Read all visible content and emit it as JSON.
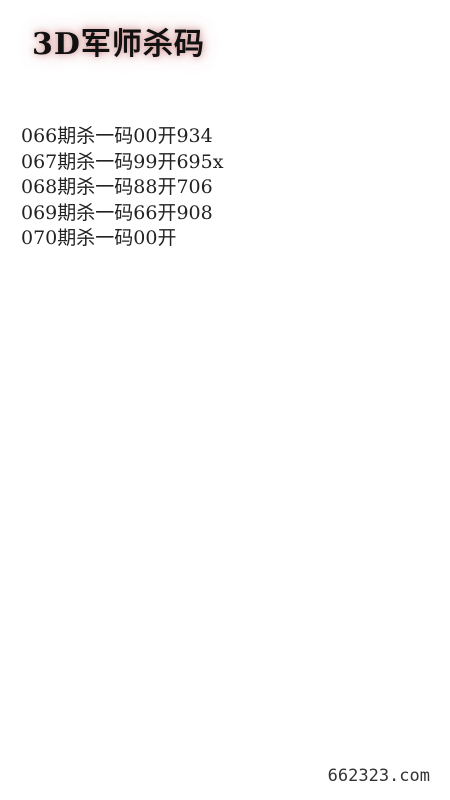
{
  "title": "3D军师杀码",
  "entries": [
    "066期杀一码00开934",
    "067期杀一码99开695x",
    "068期杀一码88开706",
    "069期杀一码66开908",
    "070期杀一码00开"
  ],
  "footer": "662323.com",
  "colors": {
    "background": "#ffffff",
    "text": "#222222",
    "title_glow": "#d49a9a"
  }
}
